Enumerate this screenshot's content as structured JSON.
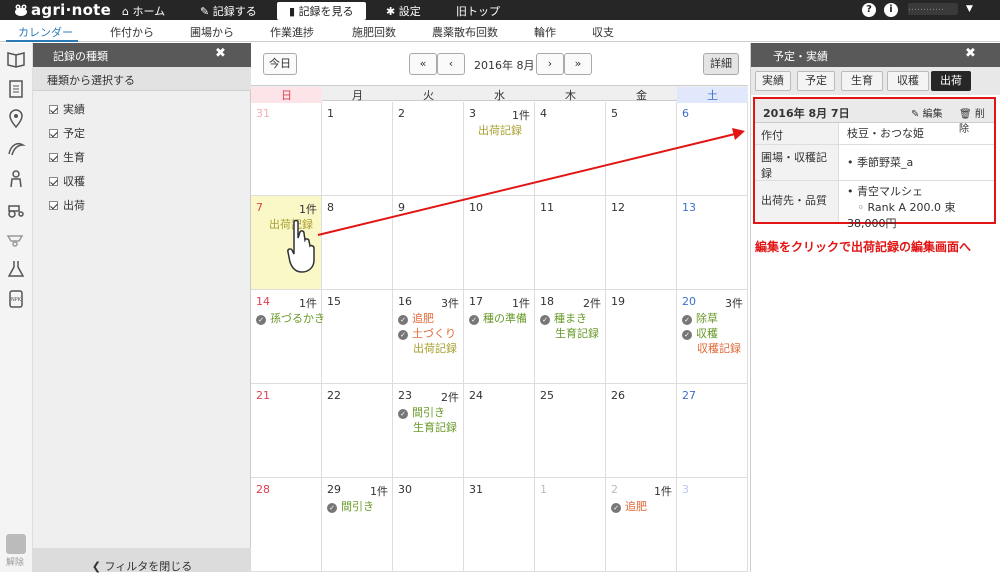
{
  "app": {
    "logo": "agri·note"
  },
  "topnav": {
    "home": "ホーム",
    "record": "記録する",
    "view": "記録を見る",
    "settings": "設定",
    "old_top": "旧トップ",
    "help": "?",
    "user_initial": "i",
    "user_name": "…………"
  },
  "tabs": [
    "カレンダー",
    "作付から",
    "圃場から",
    "作業進捗",
    "施肥回数",
    "農薬散布回数",
    "輪作",
    "収支"
  ],
  "filter": {
    "title": "記録の種類",
    "subtitle": "種類から選択する",
    "items": [
      "実績",
      "予定",
      "生育",
      "収穫",
      "出荷"
    ],
    "close_filter": "フィルタを閉じる",
    "unlock_label": "解除"
  },
  "calendar": {
    "today": "今日",
    "month": "2016年 8月",
    "detail_button": "詳細",
    "weekdays": [
      "日",
      "月",
      "火",
      "水",
      "木",
      "金",
      "土"
    ],
    "weeks": [
      [
        {
          "d": "31",
          "o": true
        },
        {
          "d": "1"
        },
        {
          "d": "2"
        },
        {
          "d": "3",
          "c": "1件",
          "e": [
            {
              "t": "出荷記録",
              "k": "ship"
            }
          ]
        },
        {
          "d": "4"
        },
        {
          "d": "5"
        },
        {
          "d": "6"
        }
      ],
      [
        {
          "d": "7",
          "c": "1件",
          "e": [
            {
              "t": "出荷記録",
              "k": "ship"
            }
          ],
          "sel": true
        },
        {
          "d": "8"
        },
        {
          "d": "9"
        },
        {
          "d": "10"
        },
        {
          "d": "11"
        },
        {
          "d": "12"
        },
        {
          "d": "13"
        }
      ],
      [
        {
          "d": "14",
          "c": "1件",
          "e": [
            {
              "t": "孫づるかき",
              "k": "done"
            }
          ]
        },
        {
          "d": "15"
        },
        {
          "d": "16",
          "c": "3件",
          "e": [
            {
              "t": "追肥",
              "k": "plan"
            },
            {
              "t": "土づくり",
              "k": "plan"
            },
            {
              "t": "出荷記録",
              "k": "ship"
            }
          ]
        },
        {
          "d": "17",
          "c": "1件",
          "e": [
            {
              "t": "種の準備",
              "k": "done"
            }
          ]
        },
        {
          "d": "18",
          "c": "2件",
          "e": [
            {
              "t": "種まき",
              "k": "done"
            },
            {
              "t": "生育記録",
              "k": "grow"
            }
          ]
        },
        {
          "d": "19"
        },
        {
          "d": "20",
          "c": "3件",
          "e": [
            {
              "t": "除草",
              "k": "done"
            },
            {
              "t": "収穫",
              "k": "done"
            },
            {
              "t": "収穫記録",
              "k": "harv"
            }
          ]
        }
      ],
      [
        {
          "d": "21"
        },
        {
          "d": "22"
        },
        {
          "d": "23",
          "c": "2件",
          "e": [
            {
              "t": "間引き",
              "k": "done"
            },
            {
              "t": "生育記録",
              "k": "grow"
            }
          ]
        },
        {
          "d": "24"
        },
        {
          "d": "25"
        },
        {
          "d": "26"
        },
        {
          "d": "27"
        }
      ],
      [
        {
          "d": "28"
        },
        {
          "d": "29",
          "c": "1件",
          "e": [
            {
              "t": "間引き",
              "k": "done"
            }
          ]
        },
        {
          "d": "30"
        },
        {
          "d": "31"
        },
        {
          "d": "1",
          "o": true
        },
        {
          "d": "2",
          "o": true,
          "c": "1件",
          "e": [
            {
              "t": "追肥",
              "k": "plan"
            }
          ]
        },
        {
          "d": "3",
          "o": true
        }
      ]
    ]
  },
  "right_panel": {
    "title": "予定・実績",
    "tabs": [
      "実績",
      "予定",
      "生育",
      "収穫",
      "出荷"
    ],
    "detail": {
      "date": "2016年 8月 7日",
      "edit": "編集",
      "delete": "削除",
      "crop_label": "作付",
      "crop_value": "枝豆・おつな姫",
      "field_label": "圃場・収穫記録",
      "field_value": "季節野菜_a",
      "ship_label": "出荷先・品質",
      "ship_dest": "青空マルシェ",
      "ship_quality": "Rank A 200.0 束 38,000円"
    }
  },
  "annotation": "編集をクリックで出荷記録の編集画面へ",
  "colors": {
    "accent": "#2a7ab8",
    "red": "#e21414",
    "ship": "#a8a030",
    "done": "#6a9a2a",
    "plan": "#e06a3a",
    "grow": "#6a9a2a",
    "harv": "#e06a3a",
    "sunday": "#e04050",
    "saturday": "#3a70d0"
  }
}
